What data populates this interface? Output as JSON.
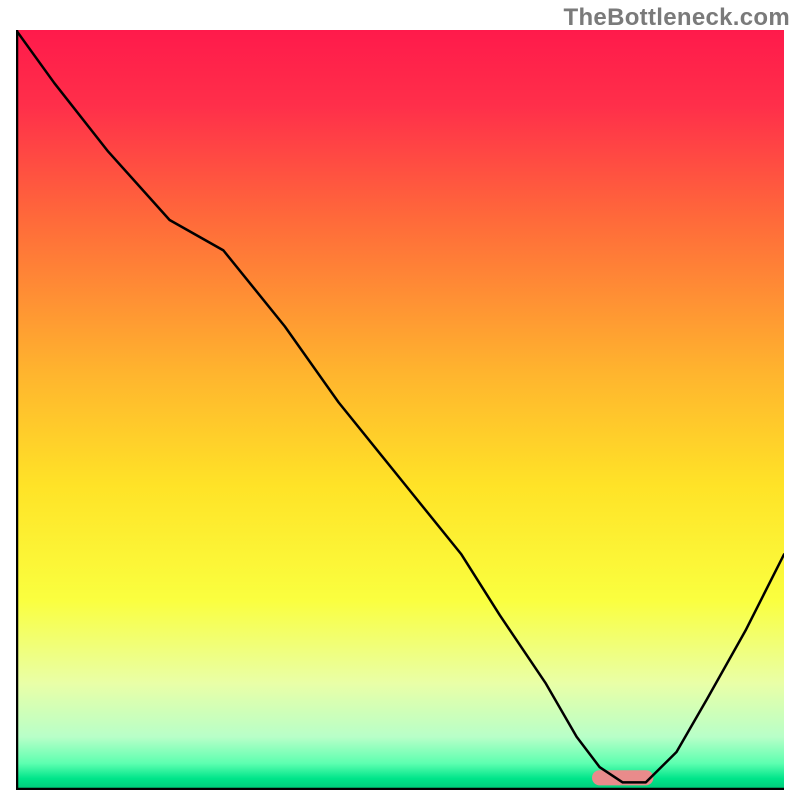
{
  "watermark": "TheBottleneck.com",
  "chart_data": {
    "type": "line",
    "title": "",
    "xlabel": "",
    "ylabel": "",
    "xlim": [
      0,
      100
    ],
    "ylim": [
      0,
      100
    ],
    "grid": false,
    "gradient_stops": [
      {
        "pos": 0.0,
        "color": "#ff1a4b"
      },
      {
        "pos": 0.1,
        "color": "#ff2f4a"
      },
      {
        "pos": 0.25,
        "color": "#ff6a3a"
      },
      {
        "pos": 0.45,
        "color": "#ffb42e"
      },
      {
        "pos": 0.6,
        "color": "#ffe327"
      },
      {
        "pos": 0.75,
        "color": "#faff3f"
      },
      {
        "pos": 0.86,
        "color": "#e9ffa7"
      },
      {
        "pos": 0.93,
        "color": "#b8ffc8"
      },
      {
        "pos": 0.965,
        "color": "#5dffb0"
      },
      {
        "pos": 0.985,
        "color": "#00e58a"
      },
      {
        "pos": 1.0,
        "color": "#00c878"
      }
    ],
    "axis_color": "#000000",
    "series": [
      {
        "name": "bottleneck-curve",
        "stroke": "#000000",
        "stroke_width": 2.5,
        "x": [
          0,
          5,
          12,
          20,
          27,
          35,
          42,
          50,
          58,
          63,
          69,
          73,
          76,
          79,
          82,
          86,
          90,
          95,
          100
        ],
        "y": [
          100,
          93,
          84,
          75,
          71,
          61,
          51,
          41,
          31,
          23,
          14,
          7,
          3,
          1,
          1,
          5,
          12,
          21,
          31
        ]
      }
    ],
    "marker": {
      "name": "optimal-range",
      "shape": "pill",
      "x_center": 79,
      "y_center": 1.6,
      "width": 8,
      "height": 2,
      "fill": "#e98b8b"
    }
  }
}
